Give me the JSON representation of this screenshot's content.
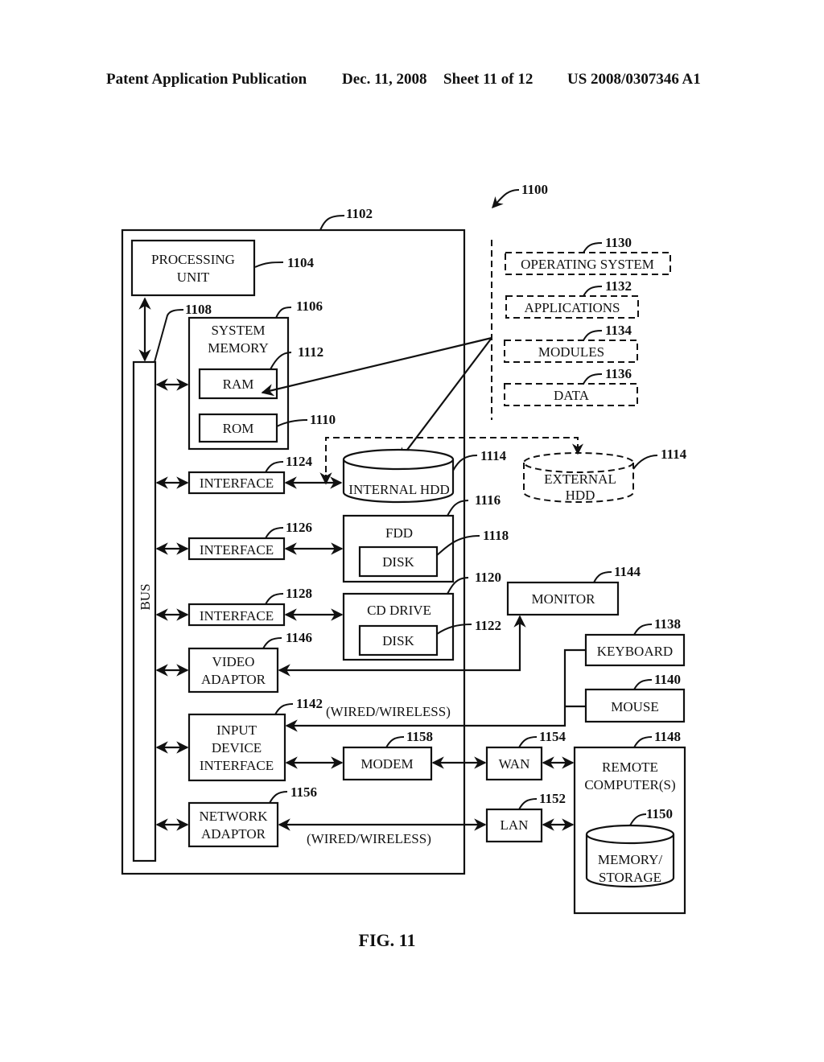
{
  "header": {
    "publication": "Patent Application Publication",
    "date": "Dec. 11, 2008",
    "sheet": "Sheet 11 of 12",
    "patent_number": "US 2008/0307346 A1"
  },
  "figure": {
    "label": "FIG. 11",
    "system_ref": "1100",
    "computer": {
      "ref": "1102"
    },
    "bus": {
      "label": "BUS",
      "ref": "1108"
    },
    "processing_unit": {
      "label_line1": "PROCESSING",
      "label_line2": "UNIT",
      "ref": "1104"
    },
    "system_memory": {
      "label_line1": "SYSTEM",
      "label_line2": "MEMORY",
      "ref": "1106"
    },
    "ram": {
      "label": "RAM",
      "ref": "1112"
    },
    "rom": {
      "label": "ROM",
      "ref": "1110"
    },
    "interface_1": {
      "label": "INTERFACE",
      "ref": "1124"
    },
    "interface_2": {
      "label": "INTERFACE",
      "ref": "1126"
    },
    "interface_3": {
      "label": "INTERFACE",
      "ref": "1128"
    },
    "internal_hdd": {
      "label": "INTERNAL HDD",
      "ref": "1114"
    },
    "external_hdd": {
      "label_line1": "EXTERNAL",
      "label_line2": "HDD",
      "ref": "1114"
    },
    "fdd": {
      "label": "FDD",
      "ref": "1116"
    },
    "fdd_disk": {
      "label": "DISK",
      "ref": "1118"
    },
    "cd_drive": {
      "label": "CD DRIVE",
      "ref": "1120"
    },
    "cd_disk": {
      "label": "DISK",
      "ref": "1122"
    },
    "video_adaptor": {
      "label_line1": "VIDEO",
      "label_line2": "ADAPTOR",
      "ref": "1146"
    },
    "input_device_interface": {
      "label_line1": "INPUT",
      "label_line2": "DEVICE",
      "label_line3": "INTERFACE",
      "ref": "1142"
    },
    "network_adaptor": {
      "label_line1": "NETWORK",
      "label_line2": "ADAPTOR",
      "ref": "1156"
    },
    "modem": {
      "label": "MODEM",
      "ref": "1158"
    },
    "monitor": {
      "label": "MONITOR",
      "ref": "1144"
    },
    "keyboard": {
      "label": "KEYBOARD",
      "ref": "1138"
    },
    "mouse": {
      "label": "MOUSE",
      "ref": "1140"
    },
    "wan": {
      "label": "WAN",
      "ref": "1154"
    },
    "lan": {
      "label": "LAN",
      "ref": "1152"
    },
    "remote_computer": {
      "label_line1": "REMOTE",
      "label_line2": "COMPUTER(S)",
      "ref": "1148"
    },
    "memory_storage": {
      "label_line1": "MEMORY/",
      "label_line2": "STORAGE",
      "ref": "1150"
    },
    "operating_system": {
      "label": "OPERATING SYSTEM",
      "ref": "1130"
    },
    "applications": {
      "label": "APPLICATIONS",
      "ref": "1132"
    },
    "modules": {
      "label": "MODULES",
      "ref": "1134"
    },
    "data": {
      "label": "DATA",
      "ref": "1136"
    },
    "wired_wireless_input": "(WIRED/WIRELESS)",
    "wired_wireless_network": "(WIRED/WIRELESS)"
  }
}
